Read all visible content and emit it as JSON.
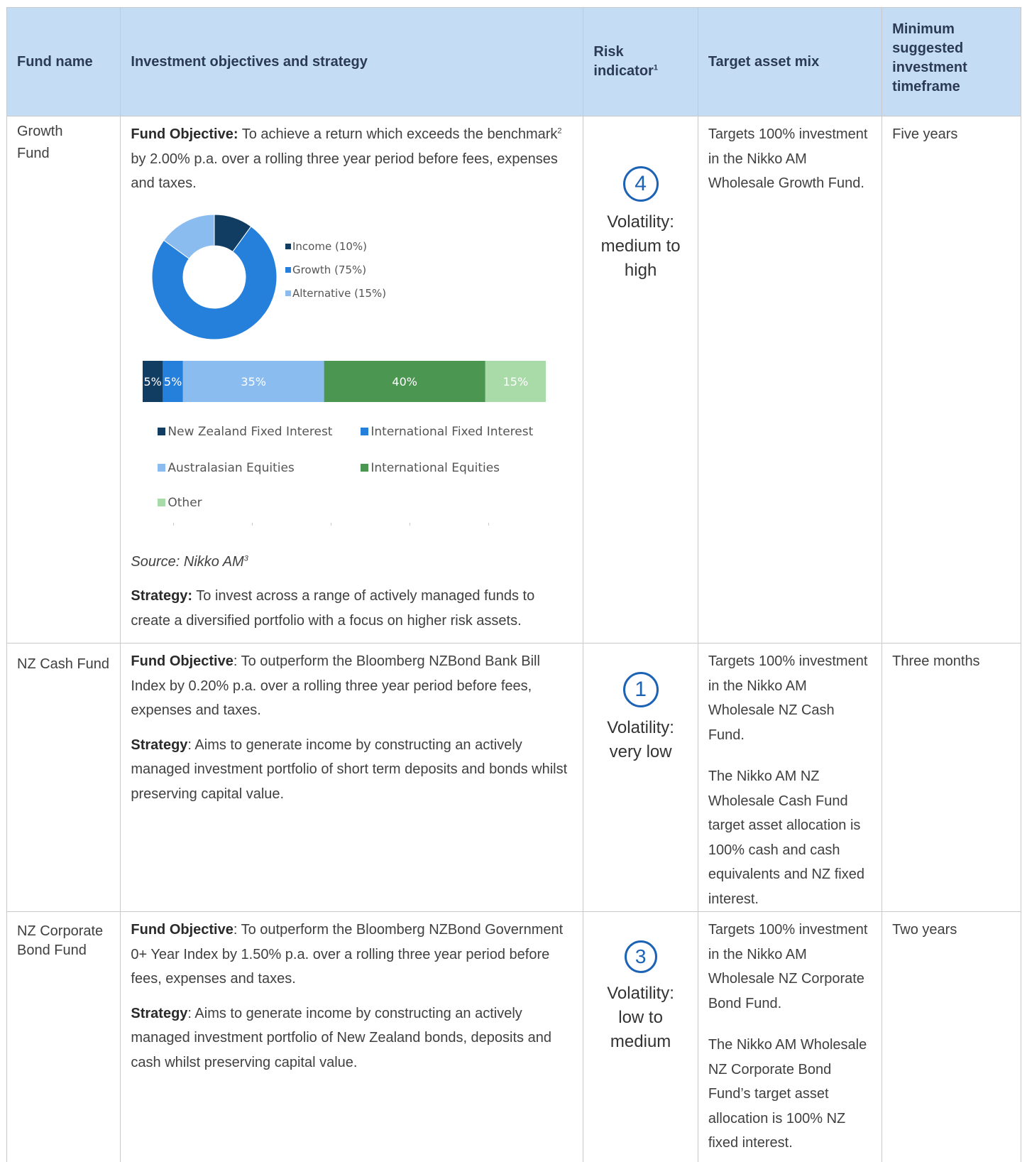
{
  "header": {
    "fund_name": "Fund name",
    "objectives": "Investment objectives and strategy",
    "risk_line1": "Risk",
    "risk_line2": "indicator",
    "risk_sup": "1",
    "asset_mix": "Target asset  mix",
    "timeframe_lines": [
      "Minimum",
      "suggested",
      "investment",
      "timeframe"
    ]
  },
  "rows": [
    {
      "name_lines": [
        "Growth",
        "Fund"
      ],
      "objective_label": "Fund Objective:",
      "objective_text_a": " To achieve a return which exceeds the benchmark",
      "objective_sup": "2",
      "objective_text_b": " by 2.00% p.a. over a rolling three year period before fees, expenses and taxes.",
      "source_text": "Source: Nikko AM",
      "source_sup": "3",
      "strategy_label": "Strategy:",
      "strategy_text": " To invest across a range of actively managed funds to create a diversified portfolio with a focus on higher risk assets.",
      "risk_level": "4",
      "risk_text_lines": [
        "Volatility:",
        "medium to",
        "high"
      ],
      "asset_mix_text": "Targets 100% investment in the Nikko AM Wholesale Growth Fund.",
      "timeframe": "Five years"
    },
    {
      "name_lines": [
        "NZ Cash Fund"
      ],
      "objective_label": "Fund Objective",
      "objective_text": ": To outperform the Bloomberg NZBond Bank Bill Index by 0.20% p.a. over a rolling three year period before fees, expenses and taxes.",
      "strategy_label": "Strategy",
      "strategy_text": ": Aims to generate income by constructing an actively managed investment portfolio of short term deposits and bonds whilst preserving capital value.",
      "risk_level": "1",
      "risk_text_lines": [
        "Volatility:",
        "very low"
      ],
      "asset_mix_text": "Targets 100% investment in the Nikko AM Wholesale NZ Cash Fund.",
      "asset_mix_text2": "The Nikko AM NZ Wholesale Cash Fund target asset allocation is 100% cash and cash equivalents and NZ fixed interest.",
      "timeframe": "Three months"
    },
    {
      "name_lines": [
        "NZ Corporate",
        "Bond Fund"
      ],
      "objective_label": "Fund Objective",
      "objective_text": ": To outperform the Bloomberg NZBond Government 0+ Year Index by 1.50% p.a. over a rolling three year period before fees, expenses and taxes.",
      "strategy_label": "Strategy",
      "strategy_text": ": Aims to generate income by constructing an actively managed investment portfolio of New Zealand bonds, deposits and cash whilst preserving capital value.",
      "risk_level": "3",
      "risk_text_lines": [
        "Volatility:",
        "low to",
        "medium"
      ],
      "asset_mix_text": "Targets 100% investment in the Nikko AM Wholesale NZ Corporate Bond Fund.",
      "asset_mix_text2": "The Nikko AM Wholesale NZ Corporate Bond Fund’s target asset allocation is 100% NZ fixed interest.",
      "timeframe": "Two years"
    }
  ],
  "chart_data": [
    {
      "type": "pie",
      "variant": "donut",
      "categories": [
        "Income (10%)",
        "Growth (75%)",
        "Alternative (15%)"
      ],
      "values": [
        10,
        75,
        15
      ],
      "colors": [
        "#123d63",
        "#2580dc",
        "#8bbcef"
      ],
      "legend_position": "right"
    },
    {
      "type": "bar",
      "variant": "100% stacked horizontal",
      "categories": [
        "New Zealand Fixed Interest",
        "International Fixed Interest",
        "Australasian Equities",
        "International Equities",
        "Other"
      ],
      "values": [
        5,
        5,
        35,
        40,
        15
      ],
      "labels": [
        "5%",
        "5%",
        "35%",
        "40%",
        "15%"
      ],
      "colors": [
        "#123d63",
        "#2580dc",
        "#8bbcef",
        "#4b9651",
        "#a9dba8"
      ],
      "legend_position": "bottom"
    }
  ]
}
